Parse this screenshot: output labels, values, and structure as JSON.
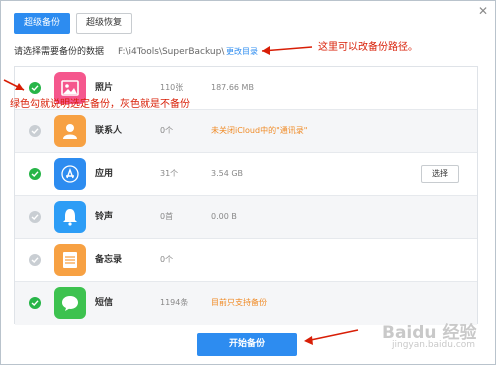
{
  "window": {
    "close_glyph": "✕"
  },
  "tabs": [
    {
      "label": "超级备份",
      "active": true
    },
    {
      "label": "超级恢复",
      "active": false
    }
  ],
  "header": {
    "prompt": "请选择需要备份的数据",
    "path": "F:\\i4Tools\\SuperBackup\\",
    "change_dir": "更改目录"
  },
  "rows": [
    {
      "name": "照片",
      "count": "110张",
      "size": "187.66 MB",
      "note": "",
      "checked": true,
      "icon": "photo-icon",
      "color": "#f5578d"
    },
    {
      "name": "联系人",
      "count": "0个",
      "size": "",
      "note": "未关闭iCloud中的\"通讯录\"",
      "checked": false,
      "icon": "contact-icon",
      "color": "#f7a143"
    },
    {
      "name": "应用",
      "count": "31个",
      "size": "3.54 GB",
      "note": "",
      "checked": true,
      "icon": "app-store-icon",
      "color": "#2d8cf0",
      "action": "选择"
    },
    {
      "name": "铃声",
      "count": "0首",
      "size": "0.00 B",
      "note": "",
      "checked": false,
      "icon": "bell-icon",
      "color": "#2d9df6"
    },
    {
      "name": "备忘录",
      "count": "0个",
      "size": "",
      "note": "",
      "checked": false,
      "icon": "notes-icon",
      "color": "#f7a143"
    },
    {
      "name": "短信",
      "count": "1194条",
      "size": "",
      "note": "目前只支持备份",
      "checked": true,
      "icon": "message-icon",
      "color": "#3dc24f"
    }
  ],
  "start_button": "开始备份",
  "annotations": {
    "path_note": "这里可以改备份路径。",
    "check_note": "绿色勾就说明选定备份，灰色就是不备份"
  },
  "watermark": {
    "logo": "Baidu 经验",
    "sub": "jingyan.baidu.com"
  },
  "colors": {
    "accent": "#2d8cf0",
    "checked": "#27b548",
    "unchecked": "#c9ced3",
    "warning": "#f08a24",
    "annotation": "#d81e06"
  }
}
